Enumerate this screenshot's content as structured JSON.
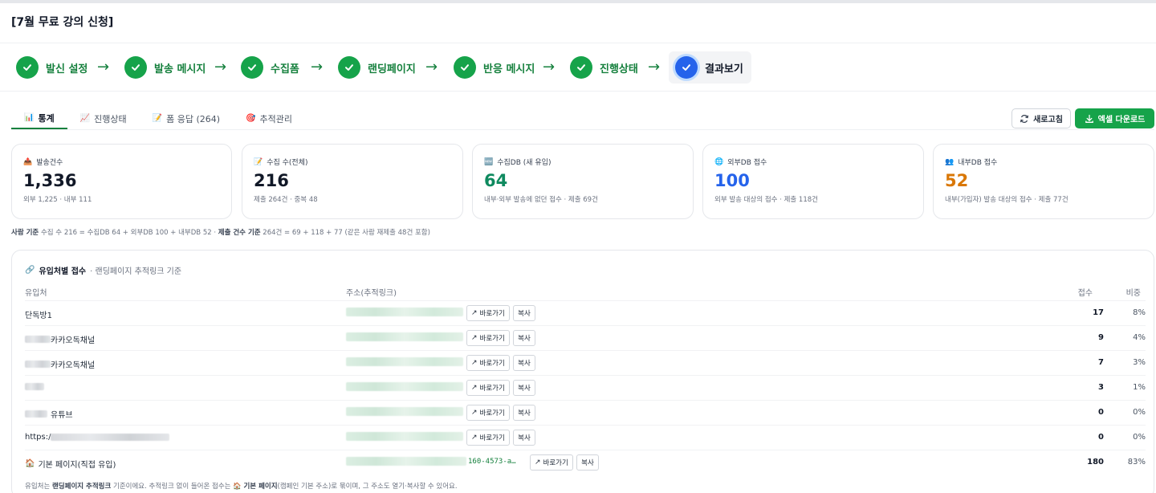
{
  "page": {
    "title": "[7월 무료 강의 신청]"
  },
  "steps": [
    {
      "label": "발신 설정"
    },
    {
      "label": "발송 메시지"
    },
    {
      "label": "수집폼"
    },
    {
      "label": "랜딩페이지"
    },
    {
      "label": "반응 메시지"
    },
    {
      "label": "진행상태"
    },
    {
      "label": "결과보기"
    }
  ],
  "step_arrow": "→",
  "tabs": [
    {
      "label": "통계",
      "icon": "📊"
    },
    {
      "label": "진행상태",
      "icon": "📈"
    },
    {
      "label": "폼 응답 (264)",
      "icon": "📝"
    },
    {
      "label": "추적관리",
      "icon": "🎯"
    }
  ],
  "toolbar": {
    "refresh_label": "새로고침",
    "excel_label": "엑셀 다운로드"
  },
  "cards": [
    {
      "icon": "📤",
      "label": "발송건수",
      "value": "1,336",
      "sub": "외부 1,225 · 내부 111",
      "color": "#111827"
    },
    {
      "icon": "📝",
      "label": "수집 수(전체)",
      "value": "216",
      "sub": "제출 264건 · 중복 48",
      "color": "#111827"
    },
    {
      "icon": "🆕",
      "label": "수집DB (새 유입)",
      "value": "64",
      "sub": "내부·외부 발송에 없던 접수 · 제출 69건",
      "color": "#0f8a5f"
    },
    {
      "icon": "🌐",
      "label": "외부DB 접수",
      "value": "100",
      "sub": "외부 발송 대상의 접수 · 제출 118건",
      "color": "#2563eb"
    },
    {
      "icon": "👥",
      "label": "내부DB 접수",
      "value": "52",
      "sub": "내부(가입자) 발송 대상의 접수 · 제출 77건",
      "color": "#d97706"
    }
  ],
  "formula": {
    "b1": "사람 기준",
    "t1": " 수집 수 216 = 수집DB 64 + 외부DB 100 + 내부DB 52 · ",
    "b2": "제출 건수 기준",
    "t2": " 264건 = 69 + 118 + 77 (같은 사람 재제출 48건 포함)"
  },
  "panel": {
    "title": "유입처별 접수",
    "subtitle": "· 랜딩페이지 추적링크 기준",
    "link_icon": "🔗",
    "headers": {
      "source": "유입처",
      "address": "주소(추적링크)",
      "count": "접수",
      "ratio": "비중"
    },
    "go_label": "바로가기",
    "copy_label": "복사",
    "rows": [
      {
        "source": "단독방1",
        "blur_prefix": 0,
        "count": "17",
        "ratio": "8%"
      },
      {
        "source": "카카오독채널",
        "blur_prefix": 32,
        "count": "9",
        "ratio": "4%"
      },
      {
        "source": "카카오독채널",
        "blur_prefix": 32,
        "count": "7",
        "ratio": "3%"
      },
      {
        "source": "",
        "blur_prefix": 24,
        "count": "3",
        "ratio": "1%"
      },
      {
        "source": "유튜브",
        "blur_prefix": 28,
        "count": "0",
        "ratio": "0%"
      },
      {
        "source": "https:/",
        "blur_prefix": 0,
        "blur_suffix": 148,
        "count": "0",
        "ratio": "0%"
      },
      {
        "source": "기본 페이지(직접 유입)",
        "icon": "🏠",
        "link": "160-4573-a…",
        "count": "180",
        "ratio": "83%"
      }
    ],
    "footnote": {
      "t1": "유입처는 ",
      "b1": "랜딩페이지 추적링크",
      "t2": " 기준이에요. 추적링크 없이 들어온 접수는 🏠 ",
      "b2": "기본 페이지",
      "t3": "(캠페인 기본 주소)로 묶이며, 그 주소도 열기·복사할 수 있어요."
    }
  }
}
